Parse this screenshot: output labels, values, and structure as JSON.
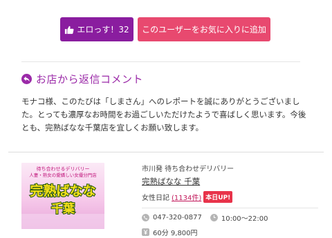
{
  "actions": {
    "like_label": "エロっす！32",
    "favorite_label": "このユーザーをお気に入りに追加"
  },
  "reply": {
    "title": "お店から返信コメント",
    "lines": [
      "モナコ様、このたびは「しまさん」へのレポートを誠にありがとうございまし",
      "た。とっても濃厚なお時間をお過ごしいただけたようで喜ばしく思います。今後",
      "とも、完熟ばなな千葉店を宜しくお願い致します。"
    ]
  },
  "shop": {
    "image_line1": "待ち合わせるデリバリー",
    "image_line2": "人妻・熟女の愛嬌しい女優分門店",
    "image_logo": "完熟ばなな",
    "image_logo_city": "千葉",
    "subtitle": "市川発 待ち合わせデリバリー",
    "name": "完熟ばなな 千葉",
    "diary_label": "女性日記",
    "diary_count": "(1134件)",
    "today_badge": "本日UP!",
    "phone": "047-320-0877",
    "hours": "10:00～22:00",
    "price": "60分 9,800円"
  },
  "colors": {
    "like_button": "#8a1d9f",
    "favorite_button": "#e8496f",
    "reply_title": "#9b2aa8",
    "today_badge": "#e8334a"
  },
  "icons": {
    "like": "thumbs-up-icon",
    "reply": "reply-arrow-icon",
    "phone": "phone-icon",
    "clock": "clock-icon",
    "price": "yen-icon"
  }
}
